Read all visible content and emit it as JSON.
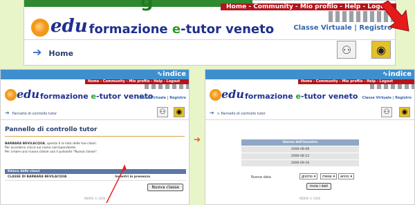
{
  "top": {
    "header_letter": "g",
    "red_links": "Home - Community - Mio profilo - Help - Logout",
    "brand_edu": "edu",
    "brand_formazione": "formazione",
    "brand_e": "e",
    "brand_rest": "-tutor veneto",
    "nav_links": "Classe Virtuale | Registro",
    "home": "Home"
  },
  "left": {
    "indice": "∿indice",
    "red_links": "Home - Community - Mio profilo - Help - Logout",
    "brand_edu": "edu",
    "brand_formazione": "formazione",
    "brand_e": "e",
    "brand_rest": "-tutor veneto",
    "nav_links": "Classe Virtuale | Registro",
    "subnav": "Pannello di controllo tutor",
    "title": "Pannello di controllo tutor",
    "intro_name": "BARBARA BEVILACQUA",
    "intro_text": ", questa è la lista delle tue classi.",
    "intro_line2": "Per accedervi clicca sul nome corrispondente.",
    "intro_line3": "Per creare una nuova classe usa il pulsante \"Nuova classe\".",
    "table_header": "Elenco delle classi",
    "row_class": "CLASSE DI BARBARA BEVILACQUA",
    "row_action": "Incontri in presenza",
    "new_class_button": "Nuova classe",
    "footer": "INDIRE © 2006"
  },
  "right": {
    "indice": "∿indice",
    "red_links": "Home - Community - Mio profilo - Help - Logout",
    "brand_edu": "edu",
    "brand_formazione": "formazione",
    "brand_e": "e",
    "brand_rest": "-tutor veneto",
    "nav_links": "Classe Virtuale | Registro",
    "subnav": "> Pannello di controllo tutor",
    "table_header": "Giorno dell'incontro",
    "dates": [
      "2006-08-08",
      "2006-08-12",
      "2006-09-16"
    ],
    "new_date_label": "Nuova data",
    "select_day": "giorno",
    "select_month": "mese",
    "select_year": "anno",
    "send_button": "invia i dati",
    "footer": "INDIRE © 2006"
  }
}
